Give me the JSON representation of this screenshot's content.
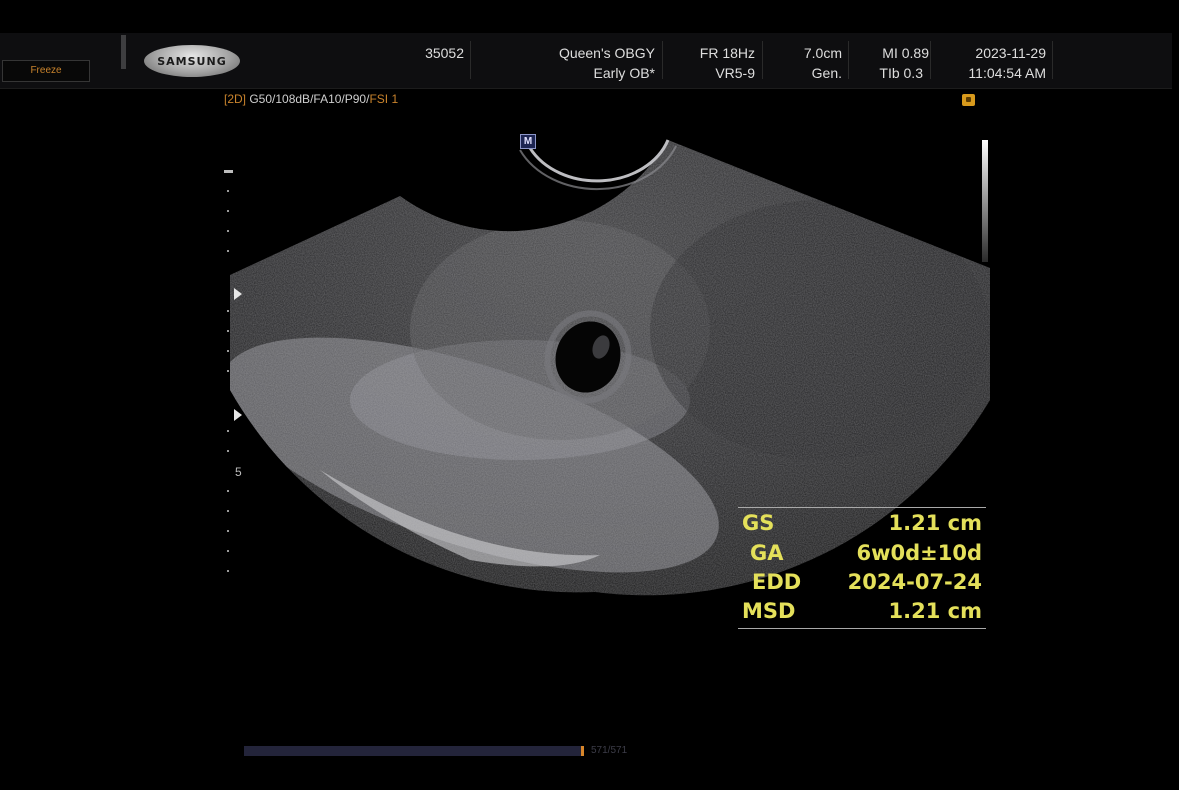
{
  "header": {
    "freeze_label": "Freeze",
    "logo_text": "SAMSUNG",
    "patient_id": "35052",
    "institution": "Queen's OBGY",
    "exam_preset": "Early OB*",
    "frame_rate": "FR 18Hz",
    "probe": "VR5-9",
    "depth": "7.0cm",
    "mode": "Gen.",
    "mi": "MI 0.89",
    "tib": "TIb 0.3",
    "date": "2023-11-29",
    "time": "11:04:54 AM"
  },
  "image_params": {
    "mode_tag": "[2D]",
    "params": " G50/108dB/FA10/P90/",
    "fsi": "FSI 1"
  },
  "scale": {
    "depth_label": "5",
    "marker": "M"
  },
  "measurements": [
    {
      "label": "GS",
      "value": "1.21 cm"
    },
    {
      "label": "GA",
      "value": "6w0d±10d"
    },
    {
      "label": "EDD",
      "value": "2024-07-24"
    },
    {
      "label": "MSD",
      "value": "1.21 cm"
    }
  ],
  "cine": {
    "label": "571/571",
    "progress": 1.0
  },
  "colors": {
    "measurement_text": "#e4e05a",
    "accent_orange": "#c9832c",
    "lock_icon": "#d89a1c"
  },
  "icons": [
    "lock-icon",
    "focus-marker-icon",
    "m-marker-icon"
  ]
}
